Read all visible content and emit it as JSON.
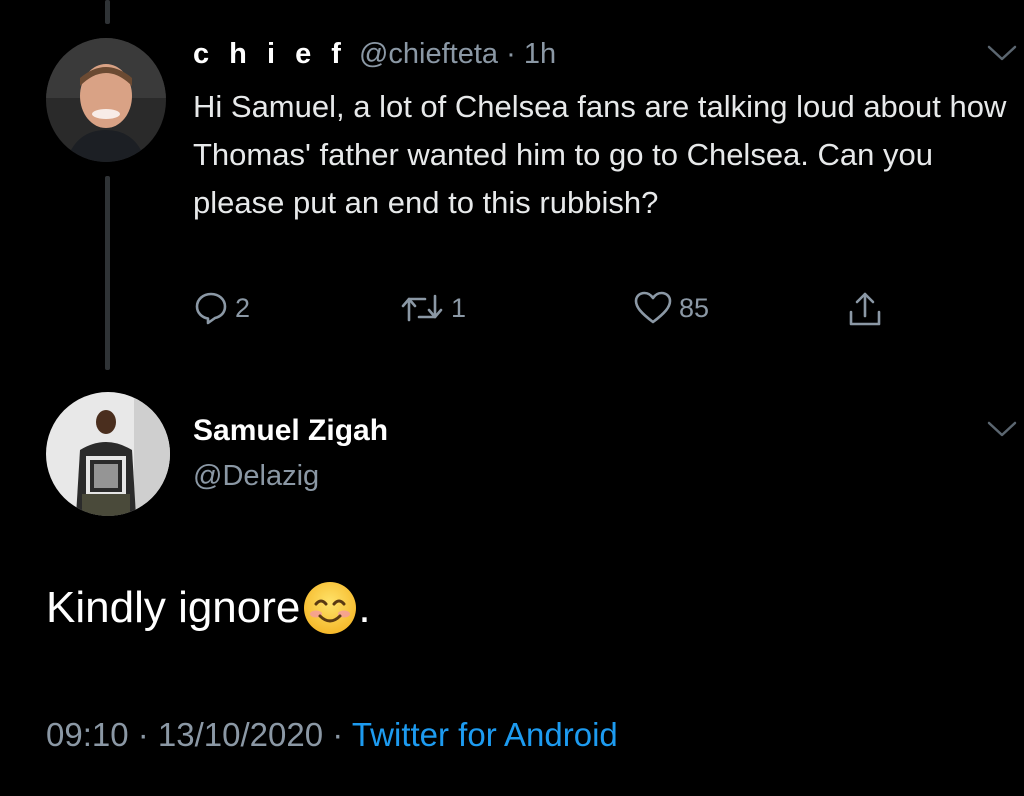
{
  "reply_tweet": {
    "display_name": "c h i e f",
    "handle": "@chiefteta",
    "separator": "·",
    "time": "1h",
    "text": "Hi Samuel, a lot of Chelsea fans are talking loud about how Thomas' father wanted him to go to Chelsea. Can you please put an end to this rubbish?",
    "reply_count": "2",
    "retweet_count": "1",
    "like_count": "85"
  },
  "main_tweet": {
    "display_name": "Samuel Zigah",
    "handle": "@Delazig",
    "text_before_emoji": "Kindly ignore",
    "emoji": "smiling-face-with-smiling-eyes",
    "text_after_emoji": ".",
    "timestamp": "09:10 · 13/10/2020",
    "separator": "·",
    "source": "Twitter for Android"
  },
  "colors": {
    "background": "#000000",
    "text": "#e7e9ea",
    "secondary": "#8b98a5",
    "link": "#1d9bf0",
    "thread_line": "#2f3336"
  },
  "icons": [
    "reply-icon",
    "retweet-icon",
    "like-icon",
    "share-icon",
    "chevron-down-icon"
  ]
}
